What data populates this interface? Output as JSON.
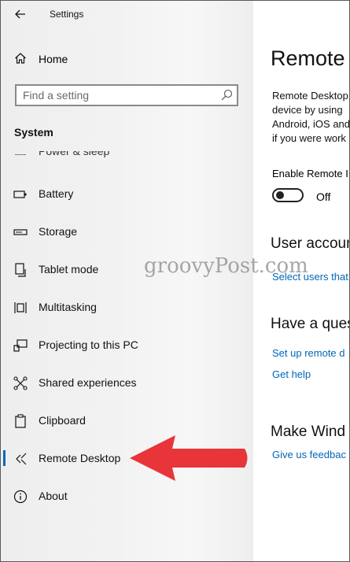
{
  "window": {
    "title": "Settings",
    "back_icon": "back-arrow-icon"
  },
  "sidebar": {
    "home_label": "Home",
    "search_placeholder": "Find a setting",
    "section": "System",
    "partial_item": "Power & sleep",
    "items": [
      {
        "label": "Battery",
        "icon": "battery-icon"
      },
      {
        "label": "Storage",
        "icon": "storage-icon"
      },
      {
        "label": "Tablet mode",
        "icon": "tablet-mode-icon"
      },
      {
        "label": "Multitasking",
        "icon": "multitasking-icon"
      },
      {
        "label": "Projecting to this PC",
        "icon": "projecting-icon"
      },
      {
        "label": "Shared experiences",
        "icon": "shared-experiences-icon"
      },
      {
        "label": "Clipboard",
        "icon": "clipboard-icon"
      },
      {
        "label": "Remote Desktop",
        "icon": "remote-desktop-icon",
        "selected": true
      },
      {
        "label": "About",
        "icon": "info-icon"
      }
    ]
  },
  "content": {
    "title": "Remote",
    "description": [
      "Remote Desktop",
      "device by using",
      "Android, iOS and",
      "if you were work"
    ],
    "enable_label": "Enable Remote I",
    "toggle_state": "Off",
    "user_accounts_heading": "User accoun",
    "user_accounts_link": "Select users that",
    "question_heading": "Have a ques",
    "setup_link": "Set up remote d",
    "help_link": "Get help",
    "feedback_heading": "Make Wind",
    "feedback_link": "Give us feedbac"
  },
  "overlay": {
    "watermark": "groovyPost.com",
    "arrow_color": "#e8353a"
  },
  "colors": {
    "accent": "#0067c0",
    "link": "#0067b8"
  }
}
